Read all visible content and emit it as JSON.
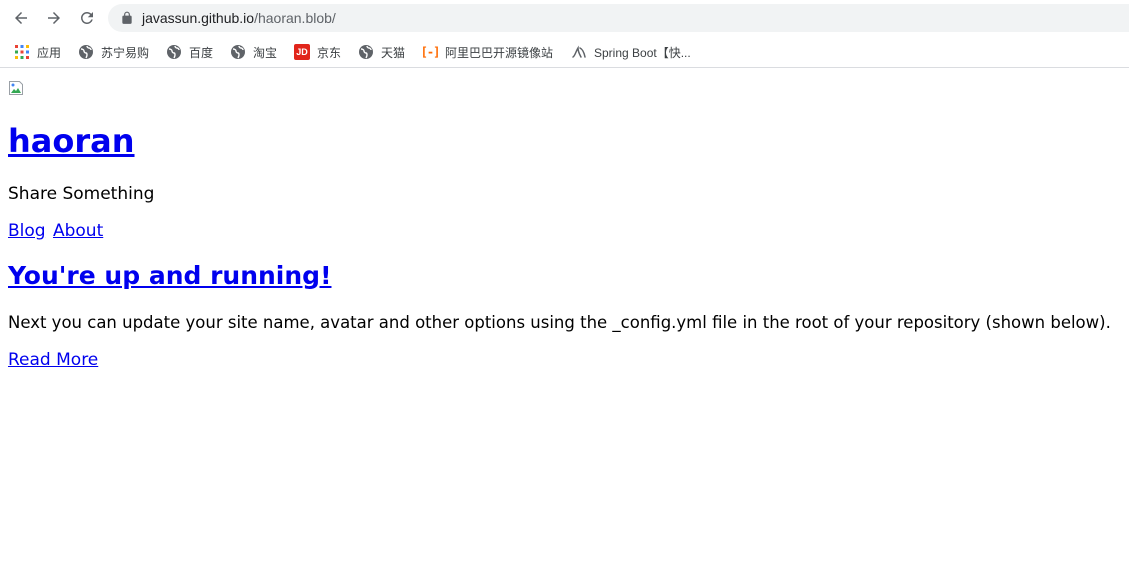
{
  "browser": {
    "url_host": "javassun.github.io",
    "url_path": "/haoran.blob/",
    "icons": {
      "back": "arrow-left-icon",
      "forward": "arrow-right-icon",
      "reload": "reload-icon",
      "lock": "lock-icon"
    }
  },
  "bookmarks": [
    {
      "label": "应用",
      "icon": "apps-grid-icon"
    },
    {
      "label": "苏宁易购",
      "icon": "globe-icon"
    },
    {
      "label": "百度",
      "icon": "globe-icon"
    },
    {
      "label": "淘宝",
      "icon": "globe-icon"
    },
    {
      "label": "京东",
      "icon": "jd-logo-icon",
      "icon_text": "JD"
    },
    {
      "label": "天猫",
      "icon": "globe-icon"
    },
    {
      "label": "阿里巴巴开源镜像站",
      "icon": "aliyun-logo-icon",
      "icon_text": "[-]"
    },
    {
      "label": "Spring Boot【快...",
      "icon": "spring-boot-icon"
    }
  ],
  "page": {
    "site_title": "haoran",
    "site_description": "Share Something",
    "nav": [
      {
        "label": "Blog"
      },
      {
        "label": "About"
      }
    ],
    "post": {
      "title": "You're up and running!",
      "excerpt": "Next you can update your site name, avatar and other options using the _config.yml file in the root of your repository (shown below).",
      "read_more": "Read More"
    }
  },
  "colors": {
    "link": "#0000ee",
    "omnibox_bg": "#f1f3f4",
    "jd_red": "#e1251b",
    "aliyun_orange": "#ff6a00"
  }
}
